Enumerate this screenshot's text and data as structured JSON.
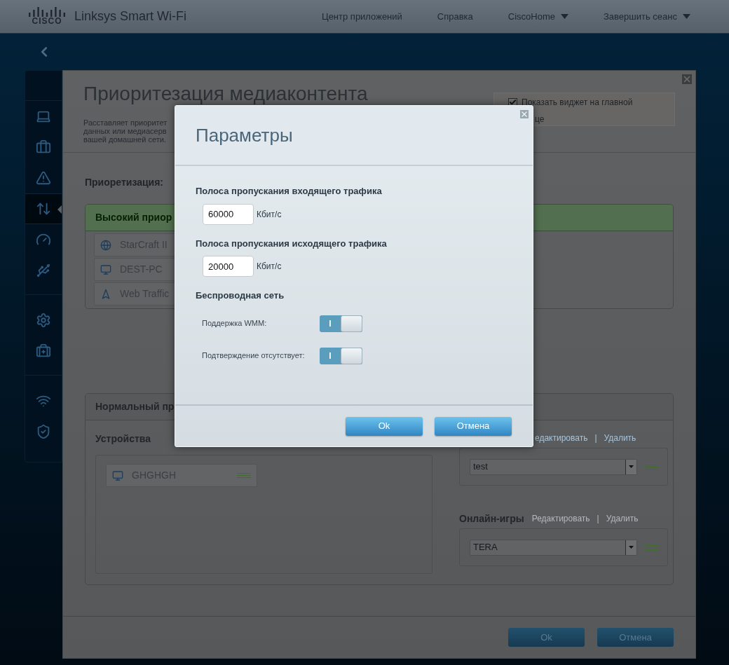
{
  "header": {
    "logo_text": "CISCO",
    "product": "Linksys Smart Wi-Fi",
    "nav": [
      {
        "label": "Центр приложений",
        "dropdown": false
      },
      {
        "label": "Справка",
        "dropdown": false
      },
      {
        "label": "CiscoHome",
        "dropdown": true
      },
      {
        "label": "Завершить сеанс",
        "dropdown": true
      }
    ]
  },
  "sidebar": {
    "groups": [
      [
        {
          "selected": false
        },
        {
          "selected": false
        },
        {
          "selected": false
        },
        {
          "selected": true
        },
        {
          "selected": false
        },
        {
          "selected": false
        }
      ],
      [
        {
          "selected": false
        },
        {
          "selected": false
        }
      ],
      [
        {
          "selected": false
        },
        {
          "selected": false
        }
      ]
    ]
  },
  "page": {
    "title": "Приоритезация медиаконтента",
    "description_lines": [
      "Расставляет приоритет",
      "данных или медиасерв",
      "вашей домашней сети."
    ],
    "widget_option": {
      "label": "Показать виджет на главной",
      "checked": true,
      "continuation": "це"
    },
    "prioritization_label": "Приоретизация:",
    "high_priority": {
      "title": "Высокий приор",
      "items": [
        {
          "name": "StarCraft II",
          "kind": "game"
        },
        {
          "name": "DEST-PC",
          "kind": "computer"
        },
        {
          "name": "Web Traffic",
          "kind": "web"
        }
      ]
    },
    "normal_priority": {
      "title": "Нормальный пр",
      "devices_label": "Устройства",
      "devices": [
        {
          "name": "GHGHGH",
          "kind": "computer"
        }
      ],
      "categories": [
        {
          "edit": "едактировать",
          "separator": "|",
          "delete": "Удалить",
          "value": "test"
        },
        {
          "title": "Онлайн-игры",
          "edit": "Редактировать",
          "separator": "|",
          "delete": "Удалить",
          "value": "TERA"
        }
      ]
    },
    "buttons": [
      "Ok",
      "Отмена"
    ]
  },
  "dialog": {
    "title": "Параметры",
    "fields": [
      {
        "label": "Полоса пропускания входящего трафика",
        "value": "60000",
        "unit": "Кбит/с"
      },
      {
        "label": "Полоса пропускания исходящего трафика",
        "value": "20000",
        "unit": "Кбит/с"
      }
    ],
    "section_title": "Беспроводная сеть",
    "toggles": [
      {
        "label": "Поддержка WMM:",
        "on": true,
        "mark": "I"
      },
      {
        "label": "Подтверждение отсутствует:",
        "on": true,
        "mark": "I"
      }
    ],
    "buttons": [
      "Ok",
      "Отмена"
    ]
  }
}
